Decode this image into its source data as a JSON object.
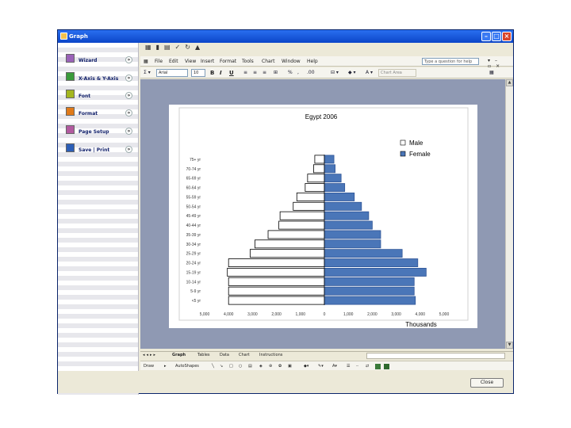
{
  "window": {
    "title": "Graph"
  },
  "sidebar": {
    "items": [
      {
        "label": "Wizard",
        "icon": "wizard-icon",
        "color": "#9a62b8"
      },
      {
        "label": "X-Axis & Y-Axis",
        "icon": "axes-icon",
        "color": "#3a9b3a"
      },
      {
        "label": "Font",
        "icon": "font-icon",
        "color": "#a4b61f"
      },
      {
        "label": "Format",
        "icon": "format-icon",
        "color": "#e07a1a"
      },
      {
        "label": "Page Setup",
        "icon": "page-setup-icon",
        "color": "#b25aa0"
      },
      {
        "label": "Save | Print",
        "icon": "save-icon",
        "color": "#2c5eb7"
      }
    ]
  },
  "menubar": {
    "items": [
      "File",
      "Edit",
      "View",
      "Insert",
      "Format",
      "Tools",
      "Chart",
      "Window",
      "Help"
    ],
    "ask_placeholder": "Type a question for help"
  },
  "formatting": {
    "font_name": "Arial",
    "font_size": "10",
    "chart_object": "Chart Area",
    "bold": "B",
    "italic": "I",
    "underline": "U"
  },
  "sheet_tabs": [
    "Graph",
    "Tables",
    "Data",
    "Chart",
    "Instructions"
  ],
  "drawing_toolbar": {
    "draw_label": "Draw",
    "autoshapes_label": "AutoShapes"
  },
  "close_button": "Close",
  "chart_data": {
    "type": "bar",
    "subtype": "population-pyramid",
    "title": "Egypt 2006",
    "categories": [
      "<5 yr",
      "5-9 yr",
      "10-14 yr",
      "15-19 yr",
      "20-24 yr",
      "25-29 yr",
      "30-34 yr",
      "35-39 yr",
      "40-44 yr",
      "45-49 yr",
      "50-54 yr",
      "55-59 yr",
      "60-64 yr",
      "65-69 yr",
      "70-74 yr",
      "75+ yr"
    ],
    "series": [
      {
        "name": "Male",
        "values": [
          -4000,
          -4000,
          -4000,
          -4050,
          -4000,
          -3100,
          -2900,
          -2350,
          -1900,
          -1850,
          -1300,
          -1150,
          -800,
          -700,
          -450,
          -400
        ],
        "color": "#ffffff"
      },
      {
        "name": "Female",
        "values": [
          3800,
          3750,
          3750,
          4250,
          3900,
          3250,
          2350,
          2350,
          2000,
          1850,
          1550,
          1250,
          850,
          700,
          450,
          400
        ],
        "color": "#4a76b8"
      }
    ],
    "xlim": [
      -5000,
      5000
    ],
    "x_ticks": [
      "5,000",
      "4,000",
      "3,000",
      "2,000",
      "1,000",
      "0",
      "1,000",
      "2,000",
      "3,000",
      "4,000",
      "5,000"
    ],
    "xlabel": "Thousands",
    "legend": "right",
    "grid": false
  }
}
